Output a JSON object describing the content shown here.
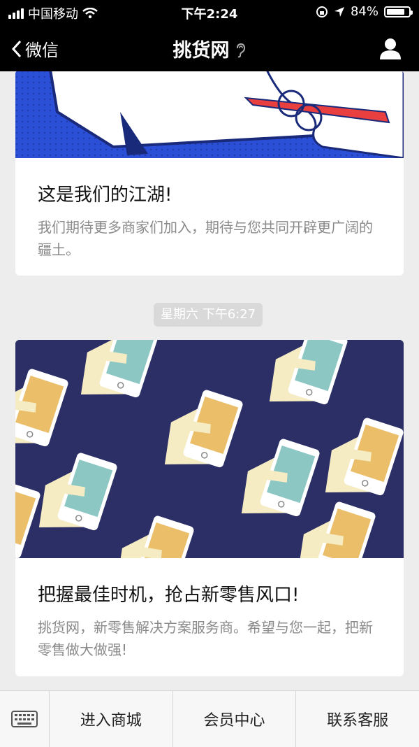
{
  "status_bar": {
    "carrier": "中国移动",
    "time": "下午2:24",
    "battery_percent": "84%",
    "battery_level": 0.84
  },
  "nav": {
    "back_label": "微信",
    "title": "挑货网",
    "icons": [
      "back-chevron-icon",
      "ear-icon",
      "profile-icon"
    ]
  },
  "messages": [
    {
      "title": "这是我们的江湖!",
      "desc": "我们期待更多商家们加入，期待与您共同开辟更广阔的疆土。"
    },
    {
      "title": "把握最佳时机，抢占新零售风口!",
      "desc": "挑货网，新零售解决方案服务商。希望与您一起，把新零售做大做强!"
    }
  ],
  "timestamp": "星期六 下午6:27",
  "bottom_menu": {
    "items": [
      "进入商城",
      "会员中心",
      "联系客服"
    ]
  },
  "colors": {
    "bar_bg": "#000000",
    "card1_image_bg": "#2c4fd8",
    "card2_image_bg": "#2b2f66",
    "hand": "#f6ecc4",
    "phone_screen_yellow": "#ebbe6a",
    "phone_screen_teal": "#8cc7c4"
  }
}
